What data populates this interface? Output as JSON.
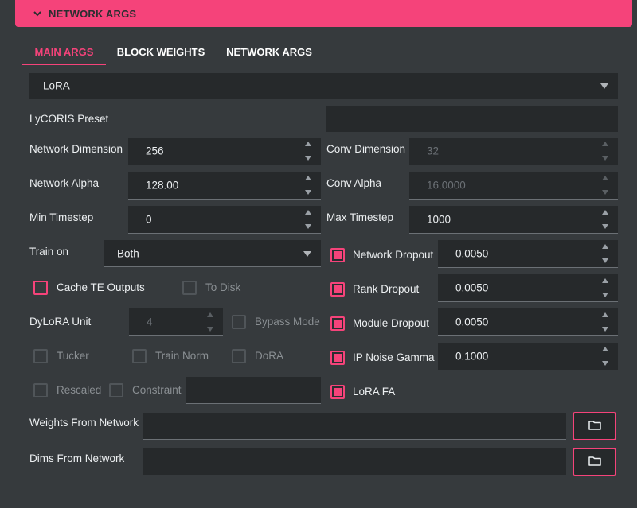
{
  "header": {
    "title": "NETWORK ARGS"
  },
  "tabs": [
    {
      "label": "MAIN ARGS",
      "active": true
    },
    {
      "label": "BLOCK WEIGHTS",
      "active": false
    },
    {
      "label": "NETWORK ARGS",
      "active": false
    }
  ],
  "network_type": {
    "selected": "LoRA"
  },
  "lycoris_preset": {
    "label": "LyCORIS Preset",
    "value": ""
  },
  "network_dimension": {
    "label": "Network Dimension",
    "value": "256"
  },
  "conv_dimension": {
    "label": "Conv Dimension",
    "value": "32"
  },
  "network_alpha": {
    "label": "Network Alpha",
    "value": "128.00"
  },
  "conv_alpha": {
    "label": "Conv Alpha",
    "value": "16.0000"
  },
  "min_timestep": {
    "label": "Min Timestep",
    "value": "0"
  },
  "max_timestep": {
    "label": "Max Timestep",
    "value": "1000"
  },
  "train_on": {
    "label": "Train on",
    "selected": "Both"
  },
  "network_dropout": {
    "label": "Network Dropout",
    "value": "0.0050",
    "checked": true
  },
  "rank_dropout": {
    "label": "Rank Dropout",
    "value": "0.0050",
    "checked": true
  },
  "module_dropout": {
    "label": "Module Dropout",
    "value": "0.0050",
    "checked": true
  },
  "ip_noise_gamma": {
    "label": "IP Noise Gamma",
    "value": "0.1000",
    "checked": true
  },
  "lora_fa": {
    "label": "LoRA FA",
    "checked": true
  },
  "cache_te": {
    "label": "Cache TE Outputs",
    "checked": false
  },
  "to_disk": {
    "label": "To Disk",
    "checked": false
  },
  "dylora_unit": {
    "label": "DyLoRA Unit",
    "value": "4"
  },
  "bypass_mode": {
    "label": "Bypass Mode",
    "checked": false
  },
  "tucker": {
    "label": "Tucker",
    "checked": false
  },
  "train_norm": {
    "label": "Train Norm",
    "checked": false
  },
  "dora": {
    "label": "DoRA",
    "checked": false
  },
  "rescaled": {
    "label": "Rescaled",
    "checked": false
  },
  "constraint": {
    "label": "Constraint",
    "checked": false,
    "value": ""
  },
  "weights_from_network": {
    "label": "Weights From Network",
    "value": ""
  },
  "dims_from_network": {
    "label": "Dims From Network",
    "value": ""
  },
  "icons": {
    "header": "chevron-down-icon",
    "folder": "folder-icon"
  },
  "colors": {
    "accent": "#f5437a",
    "background": "#363a3d",
    "field": "#26292b"
  }
}
